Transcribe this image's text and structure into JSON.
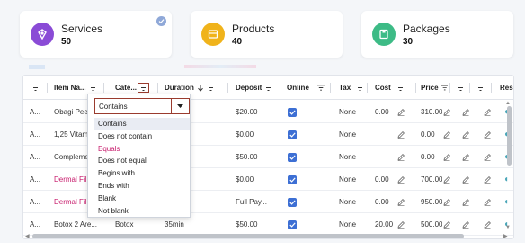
{
  "cards": [
    {
      "title": "Services",
      "count": "50",
      "color": "#8a4bd6",
      "icon": "services-icon"
    },
    {
      "title": "Products",
      "count": "40",
      "color": "#f0b31b",
      "icon": "products-icon"
    },
    {
      "title": "Packages",
      "count": "30",
      "color": "#3dbb86",
      "icon": "packages-icon"
    }
  ],
  "columns": {
    "item_name": "Item Na...",
    "category": "Cate...",
    "duration": "Duration",
    "deposit": "Deposit",
    "online": "Online",
    "tax": "Tax",
    "cost": "Cost",
    "price": "Price",
    "res": "Res"
  },
  "filter_menu": {
    "selected": "Contains",
    "options": [
      "Contains",
      "Does not contain",
      "Equals",
      "Does not equal",
      "Begins with",
      "Ends with",
      "Blank",
      "Not blank"
    ]
  },
  "rows": [
    {
      "a": "A...",
      "name": "Obagi Peel",
      "category": "",
      "duration": "",
      "deposit": "$20.00",
      "online": true,
      "tax": "None",
      "cost": "0.00",
      "price": "310.00"
    },
    {
      "a": "A...",
      "name": "1,25 Vitam",
      "category": "",
      "duration": "",
      "deposit": "$0.00",
      "online": true,
      "tax": "None",
      "cost": "",
      "price": "0.00"
    },
    {
      "a": "A...",
      "name": "Compleme...",
      "category": "",
      "duration": "",
      "deposit": "$50.00",
      "online": true,
      "tax": "None",
      "cost": "",
      "price": "0.00"
    },
    {
      "a": "A...",
      "name": "Dermal Fille...",
      "category": "",
      "duration": "",
      "deposit": "$0.00",
      "online": true,
      "tax": "None",
      "cost": "0.00",
      "price": "700.00"
    },
    {
      "a": "A...",
      "name": "Dermal Fille...",
      "category": "",
      "duration": "",
      "deposit": "Full Pay...",
      "online": true,
      "tax": "None",
      "cost": "0.00",
      "price": "950.00"
    },
    {
      "a": "A...",
      "name": "Botox 2 Are...",
      "category": "Botox",
      "duration": "35min",
      "deposit": "$50.00",
      "online": true,
      "tax": "None",
      "cost": "20.00",
      "price": "500.00"
    }
  ]
}
